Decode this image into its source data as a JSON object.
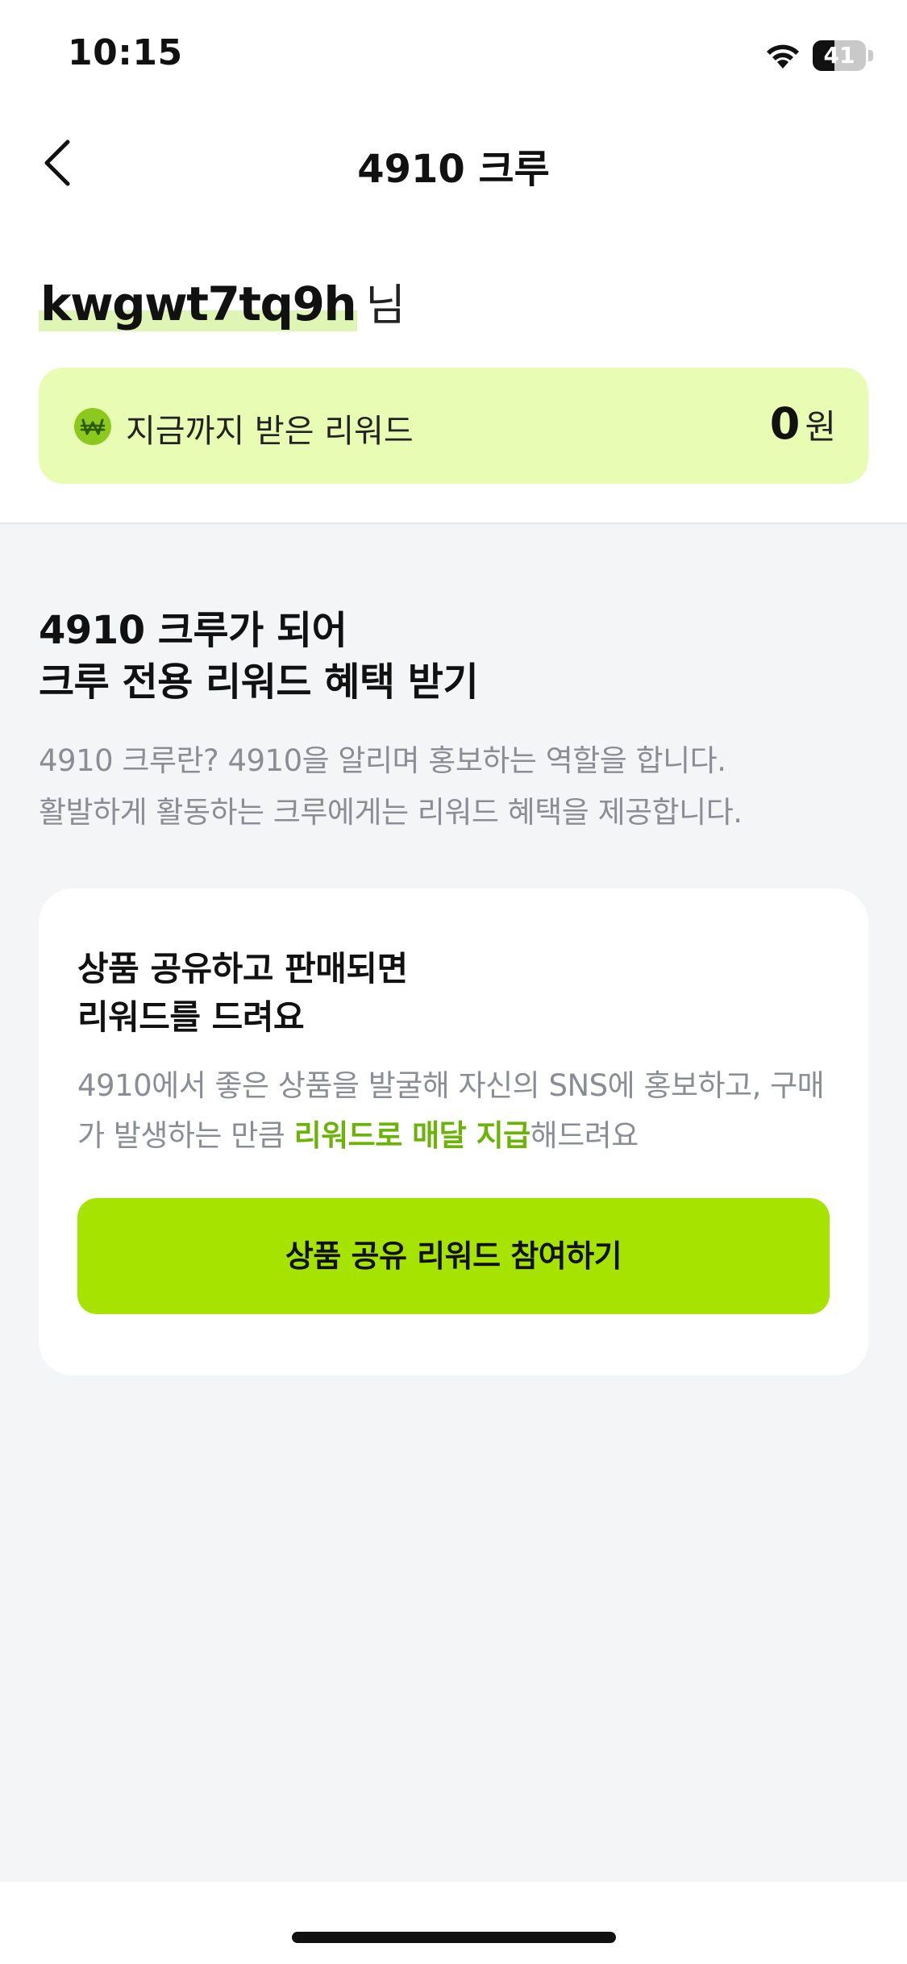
{
  "status_bar": {
    "time": "10:15",
    "battery_level": "41",
    "battery_fraction": 0.41,
    "icons": [
      "wifi-icon",
      "battery-icon"
    ]
  },
  "header": {
    "title": "4910 크루",
    "back_icon": "chevron-left-icon"
  },
  "greeting": {
    "username": "kwgwt7tq9h",
    "suffix": "님"
  },
  "reward": {
    "icon": "won-coin-icon",
    "label": "지금까지 받은 리워드",
    "amount": "0",
    "unit": "원"
  },
  "intro": {
    "title_line1": "4910 크루가 되어",
    "title_line2": "크루 전용 리워드 혜택 받기",
    "desc_line1": "4910 크루란? 4910을 알리며 홍보하는 역할을 합니다.",
    "desc_line2": "활발하게 활동하는 크루에게는 리워드 혜택을 제공합니다."
  },
  "card": {
    "title_line1": "상품 공유하고 판매되면",
    "title_line2": "리워드를 드려요",
    "desc_prefix": "4910에서 좋은 상품을 발굴해 자신의 SNS에 홍보하고, 구매가 발생하는 만큼 ",
    "desc_highlight": "리워드로 매달 지급",
    "desc_suffix": "해드려요",
    "button_label": "상품 공유 리워드 참여하기"
  },
  "colors": {
    "accent": "#a6e400",
    "reward_bg": "#e9fcb3",
    "highlight_text": "#6cb307",
    "content_bg": "#f4f5f7"
  }
}
